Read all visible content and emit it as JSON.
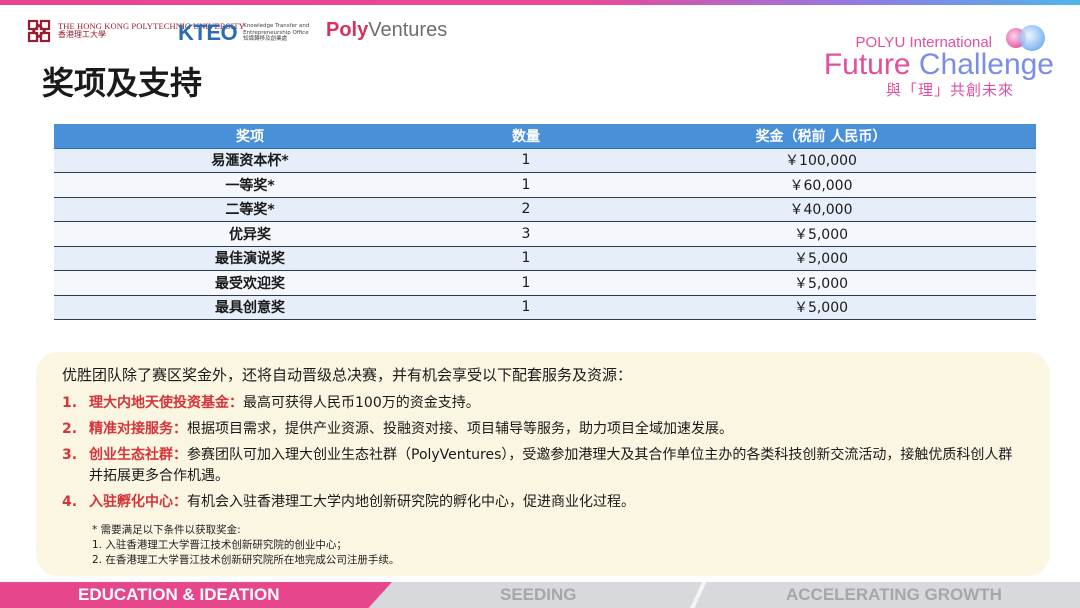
{
  "header": {
    "polyu_logo_en": "THE HONG KONG POLYTECHNIC UNIVERSITY",
    "polyu_logo_zh": "香港理工大學",
    "kteo_logo": "KTEO",
    "kteo_subtitle_1": "Knowledge Transfer and",
    "kteo_subtitle_2": "Entrepreneurship Office",
    "kteo_subtitle_zh": "知識轉移及創業處",
    "polyventures_poly": "Poly",
    "polyventures_rest": "Ventures",
    "challenge_line1": "POLYU International",
    "challenge_line2a": "Future",
    "challenge_line2b": "Challenge",
    "challenge_line3": "與「理」共創未來"
  },
  "title": "奖项及支持",
  "table": {
    "headers": [
      "奖项",
      "数量",
      "奖金（税前 人民币）"
    ],
    "rows": [
      {
        "name": "易滙资本杯*",
        "qty": "1",
        "prize": "￥100,000"
      },
      {
        "name": "一等奖*",
        "qty": "1",
        "prize": "￥60,000"
      },
      {
        "name": "二等奖*",
        "qty": "2",
        "prize": "￥40,000"
      },
      {
        "name": "优异奖",
        "qty": "3",
        "prize": "￥5,000"
      },
      {
        "name": "最佳演说奖",
        "qty": "1",
        "prize": "￥5,000"
      },
      {
        "name": "最受欢迎奖",
        "qty": "1",
        "prize": "￥5,000"
      },
      {
        "name": "最具创意奖",
        "qty": "1",
        "prize": "￥5,000"
      }
    ]
  },
  "info": {
    "intro": "优胜团队除了赛区奖金外，还将自动晋级总决赛，并有机会享受以下配套服务及资源：",
    "items": [
      {
        "num": "1.",
        "label": "理大内地天使投资基金：",
        "text": "最高可获得人民币100万的资金支持。"
      },
      {
        "num": "2.",
        "label": "精准对接服务：",
        "text": "根据项目需求，提供产业资源、投融资对接、项目辅导等服务，助力项目全域加速发展。"
      },
      {
        "num": "3.",
        "label": "创业生态社群：",
        "text": "参赛团队可加入理大创业生态社群（PolyVentures），受邀参加港理大及其合作单位主办的各类科技创新交流活动，接触优质科创人群并拓展更多合作机遇。"
      },
      {
        "num": "4.",
        "label": "入驻孵化中心：",
        "text": "有机会入驻香港理工大学内地创新研究院的孵化中心，促进商业化过程。"
      }
    ],
    "notes": [
      "* 需要满足以下条件以获取奖金:",
      "1. 入驻香港理工大学晋江技术创新研究院的创业中心；",
      "2. 在香港理工大学晋江技术创新研究院所在地完成公司注册手续。"
    ]
  },
  "footer": {
    "stage1": "EDUCATION & IDEATION",
    "stage2": "SEEDING",
    "stage3": "ACCELERATING GROWTH"
  },
  "colors": {
    "table_header": "#4a90d9",
    "accent_red": "#d4343a",
    "info_bg": "#fbf6e2",
    "footer_pink": "#e5468c"
  }
}
